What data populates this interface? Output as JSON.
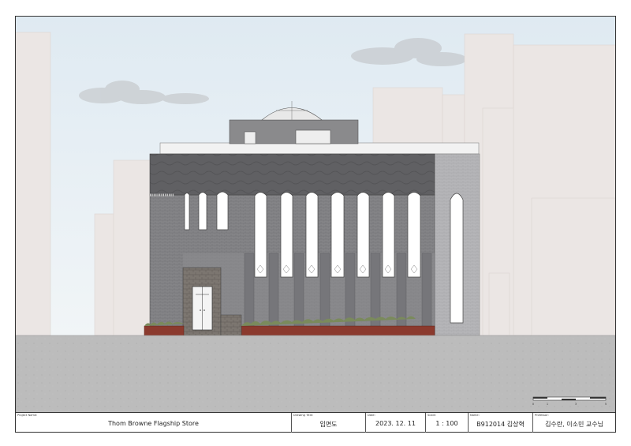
{
  "title_block": {
    "project_name": {
      "caption": "Project Name:",
      "value": "Thom Browne Flagship Store"
    },
    "drawing_title": {
      "caption": "Drawing Title:",
      "value": "입면도"
    },
    "date": {
      "caption": "Date:",
      "value": "2023. 12. 11"
    },
    "scale": {
      "caption": "Scale:",
      "value": "1 : 100"
    },
    "name": {
      "caption": "Name:",
      "value": "B912014 김상혁"
    },
    "professor": {
      "caption": "Professor:",
      "value": "김수란, 이소민 교수님"
    }
  },
  "scale_bar": {
    "ticks": [
      "0",
      "1",
      "3",
      "5"
    ]
  },
  "colors": {
    "sky": "#e4eef4",
    "background_buildings": "#ebe6e4",
    "roof_band": "#5e5e60",
    "facade": "#8a8a8c",
    "ground": "#b9b9b9",
    "brick_planter": "#8b3a2e",
    "side_wing": "#b8b8b8"
  }
}
